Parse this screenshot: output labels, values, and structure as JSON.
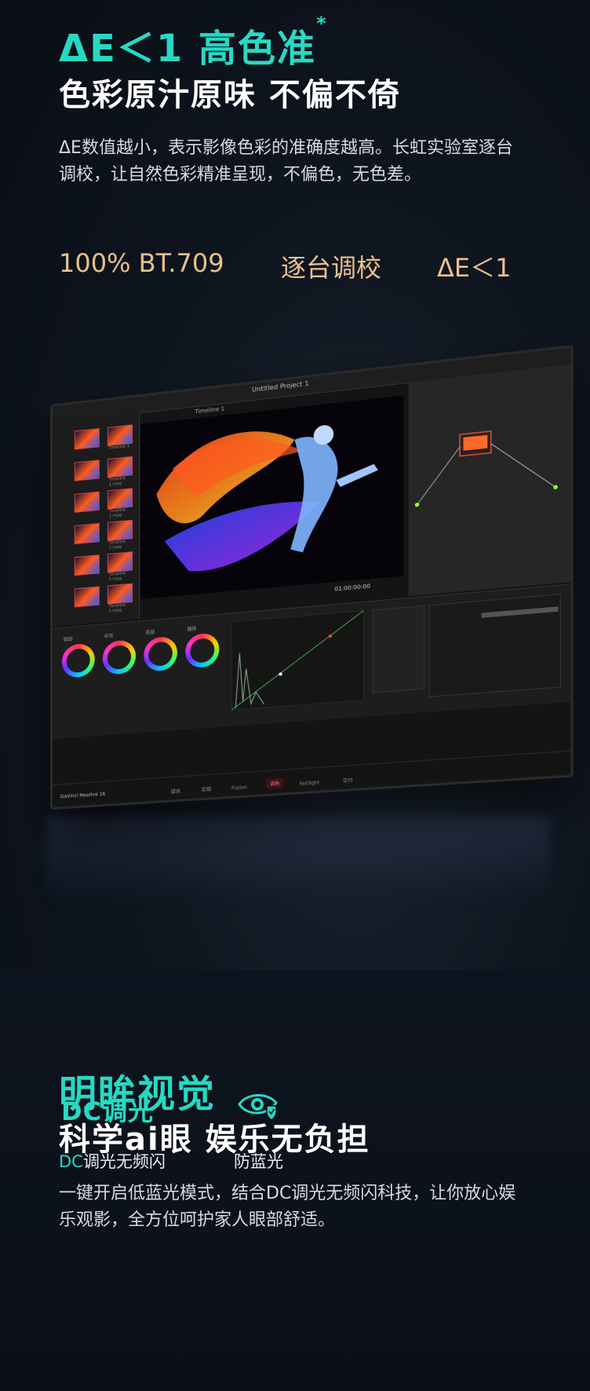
{
  "section1": {
    "headline_teal": "ΔE＜1 高色准",
    "headline_mark": "*",
    "headline_white": "色彩原汁原味 不偏不倚",
    "paragraph": "ΔE数值越小，表示影像色彩的准确度越高。长虹实验室逐台调校，让自然色彩精准呈现，不偏色，无色差。",
    "stats": [
      "100% BT.709",
      "逐台调校",
      "ΔE＜1"
    ],
    "accent_gold": "#e9c08f",
    "accent_teal": "#27d9c3"
  },
  "tv_ui": {
    "window_title": "Untitled Project 1",
    "timeline_label": "Timeline 1",
    "timecode": "01:00:00:00",
    "app_name": "DaVinci Resolve 16",
    "nav_items": [
      "媒体",
      "剪辑",
      "Fusion",
      "调色",
      "Fairlight",
      "交付"
    ],
    "thumbnails": [
      "Timeline 1",
      "Timeline 1.mpg",
      "Timeline 1.mpg",
      "Timeline 1.mpg",
      "Timeline 1.mpg",
      "Timeline 1.mpg"
    ],
    "wheel_labels": [
      "暗部",
      "中灰",
      "亮部",
      "偏移"
    ]
  },
  "section2": {
    "headline_teal": "明眸视觉",
    "headline_white": "科学ai眼 娱乐无负担",
    "paragraph": "一键开启低蓝光模式，结合DC调光无频闪科技，让你放心娱乐观影，全方位呵护家人眼部舒适。",
    "features": [
      {
        "icon": "dc-dimming-icon",
        "label_prefix": "DC",
        "label_rest": "调光无频闪",
        "icon_text": "DC调光"
      },
      {
        "icon": "eye-shield-icon",
        "label": "防蓝光"
      }
    ]
  }
}
